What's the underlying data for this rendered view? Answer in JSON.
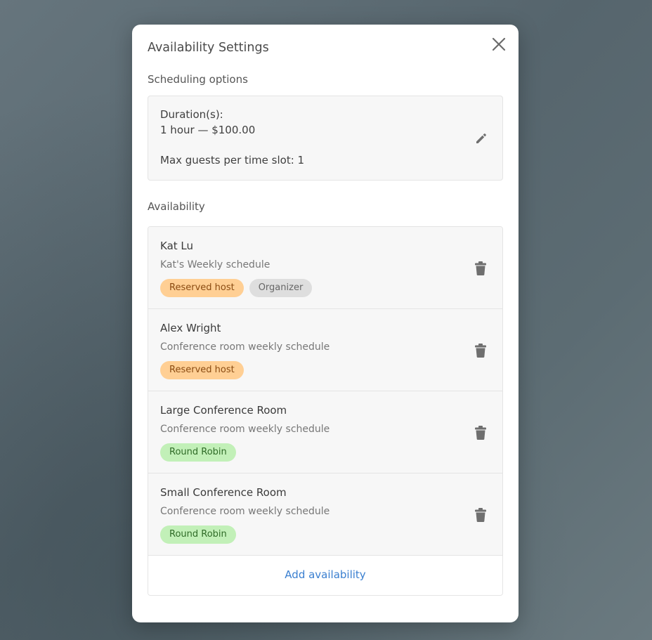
{
  "modal": {
    "title": "Availability Settings"
  },
  "scheduling": {
    "section_label": "Scheduling options",
    "duration_label": "Duration(s):",
    "duration_value": "1 hour — $100.00",
    "max_guests": "Max guests per time slot: 1",
    "edit_icon": "pencil-icon"
  },
  "availability": {
    "section_label": "Availability",
    "items": [
      {
        "name": "Kat Lu",
        "schedule": "Kat's Weekly schedule",
        "badges": [
          {
            "label": "Reserved host",
            "type": "reserved"
          },
          {
            "label": "Organizer",
            "type": "organizer"
          }
        ]
      },
      {
        "name": "Alex Wright",
        "schedule": "Conference room weekly schedule",
        "badges": [
          {
            "label": "Reserved host",
            "type": "reserved"
          }
        ]
      },
      {
        "name": "Large Conference Room",
        "schedule": "Conference room weekly schedule",
        "badges": [
          {
            "label": "Round Robin",
            "type": "robin"
          }
        ]
      },
      {
        "name": "Small Conference Room",
        "schedule": "Conference room weekly schedule",
        "badges": [
          {
            "label": "Round Robin",
            "type": "robin"
          }
        ]
      }
    ],
    "delete_icon": "trash-icon",
    "add_label": "Add availability"
  },
  "colors": {
    "link": "#3a7fd0",
    "reserved_badge": "#ffcf94",
    "organizer_badge": "#dedede",
    "robin_badge": "#c2f0b8"
  }
}
